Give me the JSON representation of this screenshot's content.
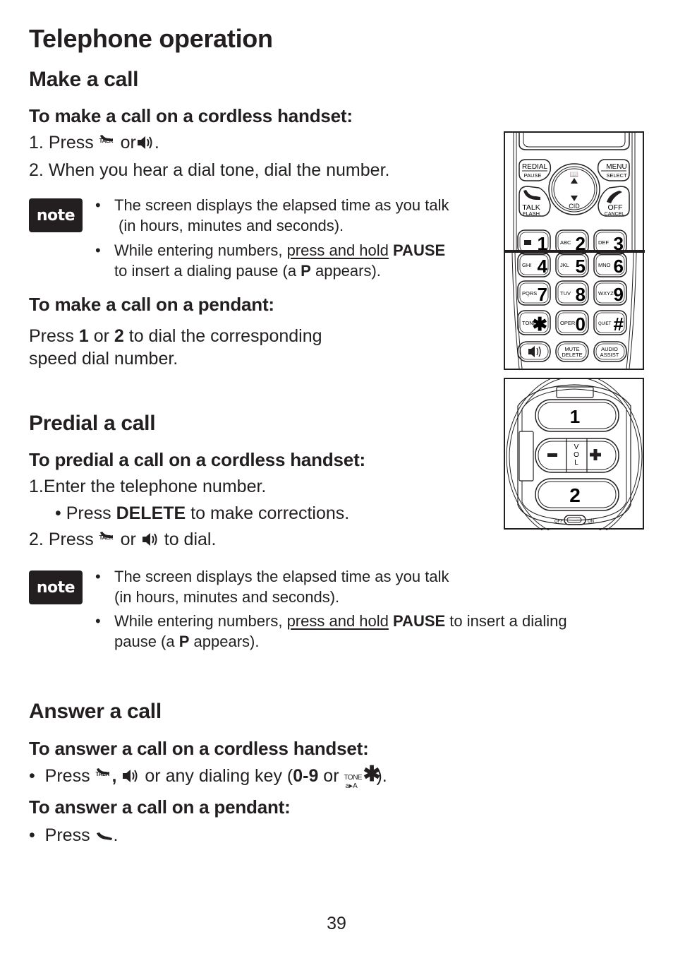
{
  "page": {
    "title": "Telephone operation",
    "page_number": "39"
  },
  "make_call": {
    "heading": "Make a call",
    "handset_heading": "To make a call on a cordless handset:",
    "steps": {
      "s1_num": "1.",
      "s1_press": "Press",
      "s1_or": "or",
      "s1_end": ".",
      "s2_num": "2.",
      "s2_text": "When you hear a dial tone, dial the number."
    },
    "note": {
      "badge": "note",
      "b1_line1": "The screen displays the elapsed time as you talk",
      "b1_line2": "(in hours, minutes and seconds).",
      "b2_pre": "While entering numbers, ",
      "b2_underline": "press and hold",
      "b2_bold": "PAUSE",
      "b2_line2_pre": "to insert a dialing pause (a ",
      "b2_line2_bold": "P",
      "b2_line2_post": " appears)."
    },
    "pendant_heading": "To make a call on a pendant:",
    "pendant_text": {
      "press": "Press ",
      "k1": "1",
      "or": " or ",
      "k2": "2",
      "rest": " to dial the corresponding",
      "line2": "speed dial number."
    }
  },
  "predial_call": {
    "heading": "Predial a call",
    "handset_heading": "To predial a call on a cordless handset:",
    "s1_num": "1.",
    "s1_text": "Enter the telephone number.",
    "sub_press": "Press ",
    "sub_bold": "DELETE",
    "sub_rest": " to make corrections.",
    "s2_num": "2.",
    "s2_press": "Press",
    "s2_or": "or",
    "s2_rest": "to dial.",
    "note": {
      "badge": "note",
      "b1_line1": "The screen displays the elapsed time as you talk",
      "b1_line2": "(in hours, minutes and seconds).",
      "b2_pre": "While entering numbers, ",
      "b2_underline": "press and hold",
      "b2_bold": "PAUSE",
      "b2_post": " to insert a dialing",
      "b2_line2_pre": "pause (a ",
      "b2_line2_bold": "P",
      "b2_line2_post": " appears)."
    }
  },
  "answer_call": {
    "heading": "Answer a call",
    "handset_heading": "To answer a call on a cordless handset:",
    "handset_press": "Press",
    "handset_comma": ",",
    "handset_mid": "or any dialing key (",
    "handset_bold": "0",
    "handset_dash": "-",
    "handset_bold2": "9",
    "handset_or": " or ",
    "handset_end": ").",
    "pendant_heading": "To answer a call on a pendant:",
    "pendant_press": "Press",
    "pendant_end": "."
  },
  "icons": {
    "talk_label": "TALK",
    "tone_label": "TONE",
    "tone_sub": "a▸A",
    "star": "✱"
  },
  "handset_illustration": {
    "redial": "REDIAL",
    "pause": "PAUSE",
    "menu": "MENU",
    "select": "SELECT",
    "talk": "TALK",
    "flash": "FLASH",
    "cid": "CID",
    "off": "OFF",
    "cancel": "CANCEL",
    "keys": [
      {
        "letters": "",
        "digit": "1"
      },
      {
        "letters": "ABC",
        "digit": "2"
      },
      {
        "letters": "DEF",
        "digit": "3"
      },
      {
        "letters": "GHI",
        "digit": "4"
      },
      {
        "letters": "JKL",
        "digit": "5"
      },
      {
        "letters": "MNO",
        "digit": "6"
      },
      {
        "letters": "PQRS",
        "digit": "7"
      },
      {
        "letters": "TUV",
        "digit": "8"
      },
      {
        "letters": "WXYZ",
        "digit": "9"
      },
      {
        "letters": "TONE",
        "digit": "✱"
      },
      {
        "letters": "OPER",
        "digit": "0"
      },
      {
        "letters": "QUIET",
        "digit": "#"
      }
    ],
    "mute": "MUTE",
    "delete": "DELETE",
    "audio": "AUDIO",
    "assist": "ASSIST"
  },
  "pendant_illustration": {
    "key1": "1",
    "key2": "2",
    "vol_v": "V",
    "vol_o": "O",
    "vol_l": "L",
    "minus": "−",
    "plus": "+",
    "off": "OFF",
    "on": "ON"
  }
}
